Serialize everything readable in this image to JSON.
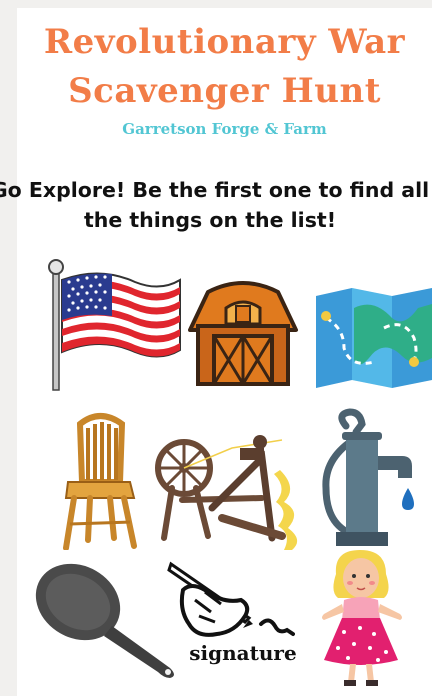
{
  "document": {
    "title_line1": "Revolutionary War",
    "title_line2": "Scavenger Hunt",
    "subtitle": "Garretson Forge & Farm",
    "instruction_line1": "Go Explore! Be the first one to find all",
    "instruction_line2": "the things on the list!"
  },
  "items": [
    {
      "name": "flag-icon"
    },
    {
      "name": "barn-icon"
    },
    {
      "name": "map-icon"
    },
    {
      "name": "chair-icon"
    },
    {
      "name": "spinning-wheel-icon"
    },
    {
      "name": "water-pump-icon"
    },
    {
      "name": "frying-pan-icon"
    },
    {
      "name": "signature-icon",
      "label": "signature"
    },
    {
      "name": "doll-icon"
    }
  ],
  "colors": {
    "title": "#f27d48",
    "subtitle": "#52c6d3",
    "page_bg": "#f1f0ee"
  }
}
